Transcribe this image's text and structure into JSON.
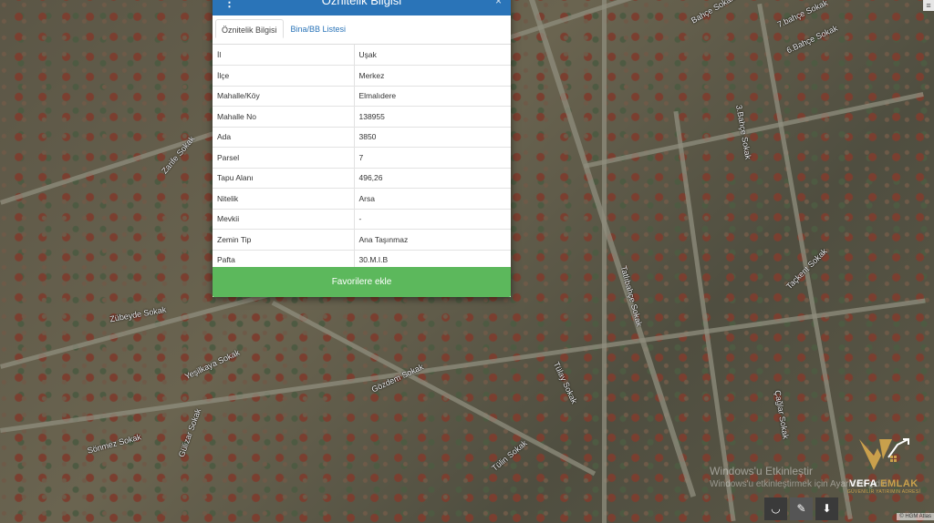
{
  "panel": {
    "title": "Öznitelik Bilgisi",
    "menu_icon": "⋮",
    "close_icon": "×",
    "tabs": [
      {
        "label": "Öznitelik Bilgisi",
        "active": true
      },
      {
        "label": "Bina/BB Listesi",
        "active": false
      }
    ],
    "rows": [
      {
        "key": "İl",
        "value": "Uşak"
      },
      {
        "key": "İlçe",
        "value": "Merkez"
      },
      {
        "key": "Mahalle/Köy",
        "value": "Elmalıdere"
      },
      {
        "key": "Mahalle No",
        "value": "138955"
      },
      {
        "key": "Ada",
        "value": "3850"
      },
      {
        "key": "Parsel",
        "value": "7"
      },
      {
        "key": "Tapu Alanı",
        "value": "496,26"
      },
      {
        "key": "Nitelik",
        "value": "Arsa"
      },
      {
        "key": "Mevkii",
        "value": "-"
      },
      {
        "key": "Zemin Tip",
        "value": "Ana Taşınmaz"
      },
      {
        "key": "Pafta",
        "value": "30.M.I.B"
      }
    ],
    "favorite_button": "Favorilere ekle"
  },
  "map": {
    "street_labels": [
      "Zarife Sokak",
      "Zübeyde Sokak",
      "Tülin Sokak",
      "Gülizar Sokak",
      "Sönmez Sokak",
      "Yeşilkaya Sokak",
      "Gözdem Sokak",
      "Tülay Sokak",
      "Tatlıbahçe Sokak",
      "3.Bahçe Sokak",
      "6.Bahçe Sokak",
      "7.bahçe Sokak",
      "Bahçe Sokak",
      "Taçkent Sokak",
      "Çağlar Sokak"
    ],
    "attribution": "© HGM Atlas"
  },
  "watermark": {
    "line1": "Windows'u Etkinleştir",
    "line2": "Windows'u etkinleştirmek için Ayarlar'a gidin."
  },
  "logo": {
    "name_part1": "VEFA",
    "name_part2": "EMLAK",
    "tagline": "GÜVENİLİR YATIRIMIN ADRESİ",
    "accent_color": "#c9a04c"
  },
  "tools": [
    {
      "icon": "eye-slash-icon",
      "glyph": "◡"
    },
    {
      "icon": "pen-icon",
      "glyph": "✎"
    },
    {
      "icon": "bookmark-icon",
      "glyph": "⬇"
    }
  ],
  "colors": {
    "header": "#2a74b8",
    "button": "#5cb85c"
  }
}
